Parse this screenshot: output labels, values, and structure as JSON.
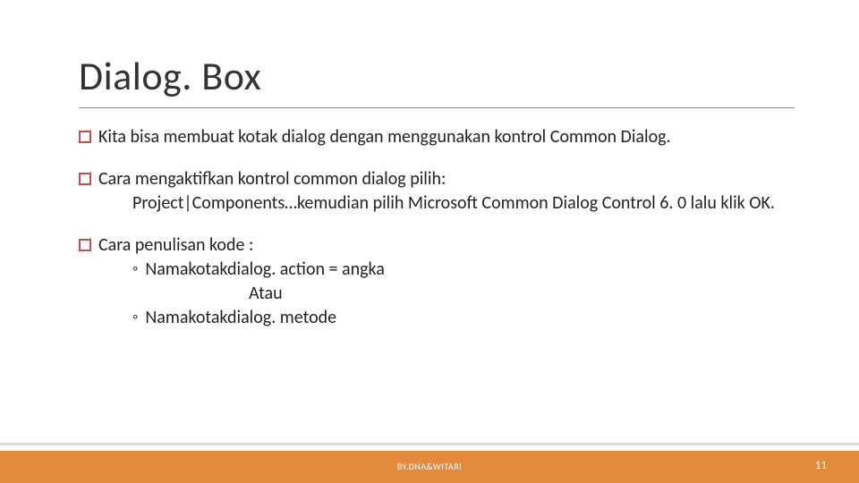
{
  "title": "Dialog. Box",
  "bullets": {
    "b1": {
      "text": "Kita bisa membuat kotak dialog dengan menggunakan kontrol Common Dialog."
    },
    "b2": {
      "text": "Cara mengaktifkan kontrol common dialog pilih:",
      "line2": "Project|Components…kemudian pilih  Microsoft Common Dialog Control 6. 0 lalu klik OK."
    },
    "b3": {
      "text": "Cara penulisan kode :",
      "s1": "Namakotakdialog. action = angka",
      "s2": "Atau",
      "s3": "Namakotakdialog. metode"
    }
  },
  "footer": {
    "credit": "BY.DNA&WITARI",
    "page": "11"
  }
}
